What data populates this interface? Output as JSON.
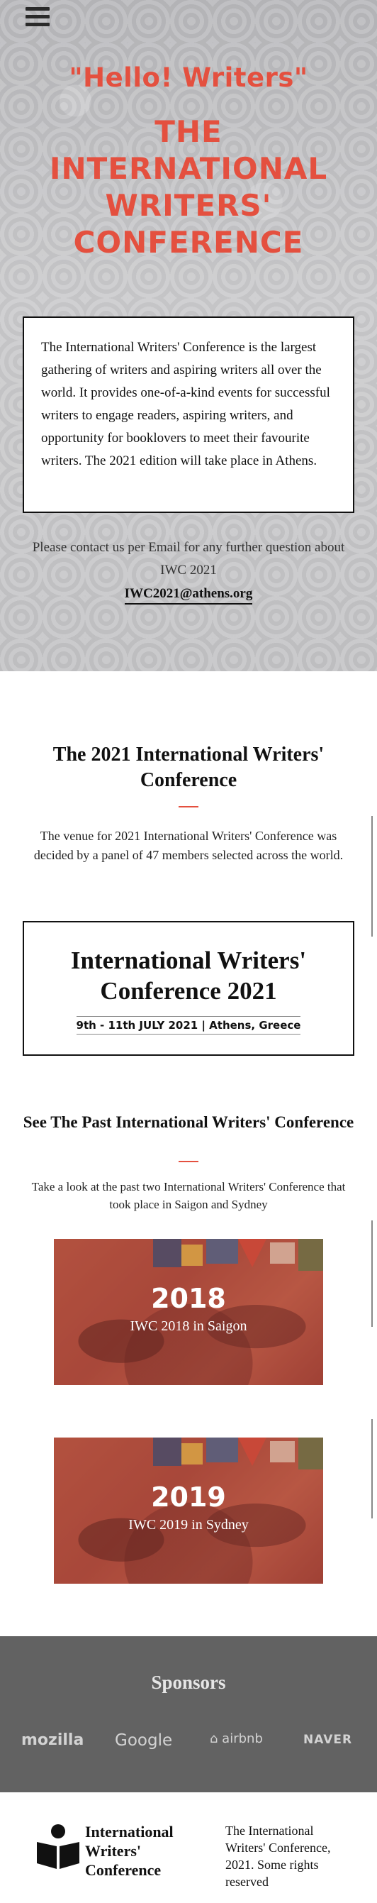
{
  "nav": {
    "menu_icon": "hamburger-menu-icon"
  },
  "hero": {
    "greeting": "\"Hello! Writers\"",
    "title": "THE INTERNATIONAL WRITERS' CONFERENCE",
    "intro": "The International Writers' Conference is the largest gathering of writers and aspiring writers all over the world. It provides one-of-a-kind events for successful writers to engage readers, aspiring writers, and opportunity for booklovers to meet their favourite writers. The 2021 edition will take place in Athens.",
    "contact_text": "Please contact us per Email for any further question about IWC 2021",
    "email": "IWC2021@athens.org"
  },
  "conference": {
    "title": "The 2021 International Writers' Conference",
    "description": "The venue for 2021 International Writers' Conference was decided by a panel of 47 members selected across the world.",
    "event_title": "International Writers' Conference 2021",
    "event_date": "9th - 11th JULY 2021 | Athens, Greece"
  },
  "past": {
    "title": "See The Past International Writers' Conference",
    "description": "Take a look at the past two International Writers' Conference that took place in Saigon and Sydney",
    "events": [
      {
        "year": "2018",
        "caption": "IWC 2018 in Saigon"
      },
      {
        "year": "2019",
        "caption": "IWC 2019 in Sydney"
      }
    ]
  },
  "sponsors": {
    "title": "Sponsors",
    "logos": [
      "mozilla",
      "Google",
      "airbnb",
      "NAVER"
    ]
  },
  "footer": {
    "brand_line1": "International",
    "brand_line2": "Writers'",
    "brand_line3": "Conference",
    "copyright": "The International Writers' Conference, 2021. Some rights reserved",
    "logo_icon": "reader-logo-icon"
  },
  "colors": {
    "accent": "#e4503f",
    "sponsor_bg": "#626262",
    "hero_bg": "#c6c6c8"
  }
}
